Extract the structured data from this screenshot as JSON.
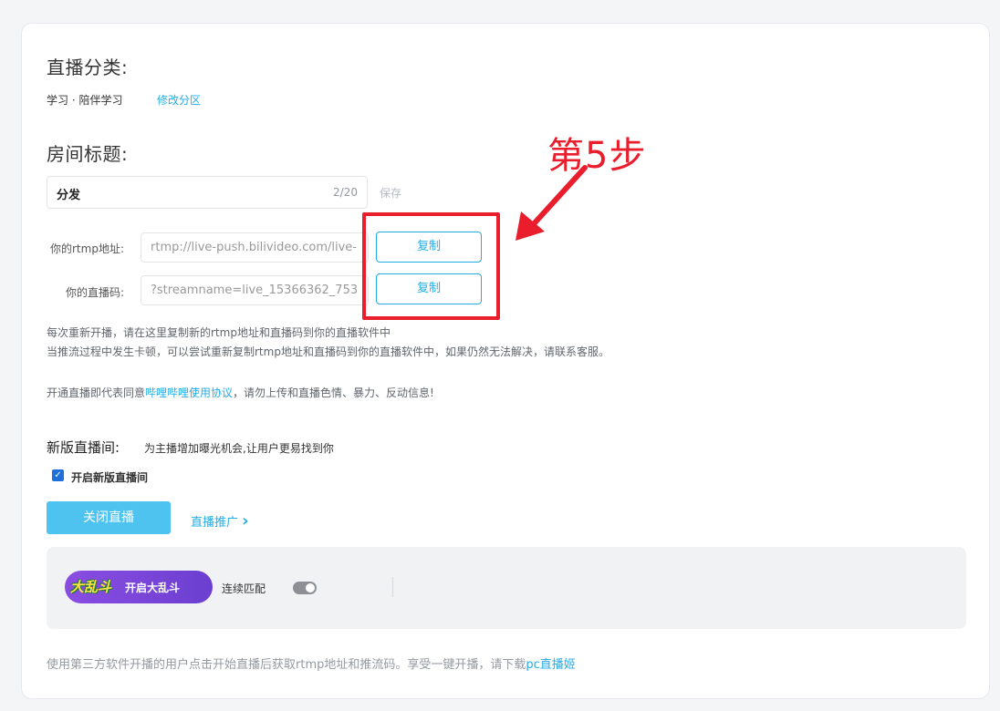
{
  "category": {
    "heading": "直播分类:",
    "value": "学习 · 陪伴学习",
    "modify_link": "修改分区"
  },
  "room_title": {
    "heading": "房间标题:",
    "input_value": "分发",
    "char_count": "2/20",
    "save_label": "保存"
  },
  "stream": {
    "rtmp_label": "你的rtmp地址:",
    "rtmp_value": "rtmp://live-push.bilivideo.com/live-",
    "key_label": "你的直播码:",
    "key_value": "?streamname=live_15366362_753",
    "copy_label": "复制"
  },
  "annotation": {
    "step_label": "第5步",
    "color": "#ea1d2c"
  },
  "notes": {
    "line1": "每次重新开播，请在这里复制新的rtmp地址和直播码到你的直播软件中",
    "line2": "当推流过程中发生卡顿，可以尝试重新复制rtmp地址和直播码到你的直播软件中，如果仍然无法解决，请联系客服。",
    "agreement_prefix": "开通直播即代表同意",
    "agreement_link": "哔哩哔哩使用协议",
    "agreement_suffix": "，请勿上传和直播色情、暴力、反动信息!"
  },
  "new_room": {
    "heading": "新版直播间:",
    "desc": "为主播增加曝光机会,让用户更易找到你",
    "checkbox_label": "开启新版直播间",
    "checked": true
  },
  "actions": {
    "close_live": "关闭直播",
    "promote": "直播推广",
    "promote_arrow": "›"
  },
  "brawl_panel": {
    "logo_text": "大乱斗",
    "button_label": "开启大乱斗",
    "match_label": "连续匹配",
    "match_enabled": false
  },
  "footer": {
    "text": "使用第三方软件开播的用户点击开始直播后获取rtmp地址和推流码。享受一键开播，请下载",
    "link": "pc直播姬"
  },
  "colors": {
    "accent": "#23ade5",
    "primary_button": "#4fc3f0",
    "checkbox": "#1e6fd9"
  }
}
